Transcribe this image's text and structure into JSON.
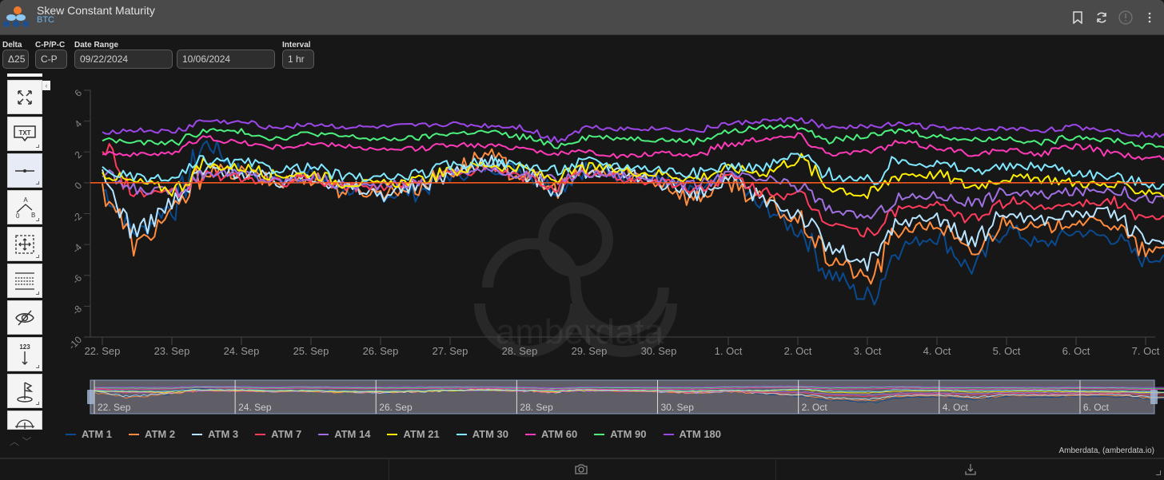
{
  "header": {
    "title": "Skew Constant Maturity",
    "subtitle": "BTC",
    "icons": [
      "bookmark-icon",
      "refresh-icon",
      "info-icon",
      "more-vertical-icon"
    ]
  },
  "controls": {
    "delta": {
      "label": "Delta",
      "value": "Δ25"
    },
    "cp": {
      "label": "C-P/P-C",
      "value": "C-P"
    },
    "date_range": {
      "label": "Date Range",
      "start": "09/22/2024",
      "end": "10/06/2024"
    },
    "interval": {
      "label": "Interval",
      "value": "1 hr"
    }
  },
  "toolbar": {
    "collapse": "‹",
    "tools": [
      {
        "name": "fullscreen",
        "icon": "fullscreen-icon"
      },
      {
        "name": "text-annotation",
        "icon": "text-annotation-icon",
        "label": "TXT"
      },
      {
        "name": "horizontal-line",
        "icon": "horizontal-line-icon",
        "active": true
      },
      {
        "name": "measure-angle",
        "icon": "measure-icon"
      },
      {
        "name": "crosshair-move",
        "icon": "move-icon"
      },
      {
        "name": "fibonacci",
        "icon": "fibonacci-icon"
      },
      {
        "name": "hide-annotations",
        "icon": "eye-off-icon"
      },
      {
        "name": "vertical-counter",
        "icon": "counter-icon",
        "label": "123"
      },
      {
        "name": "flag",
        "icon": "flag-icon"
      },
      {
        "name": "more-tools",
        "icon": "arc-icon"
      }
    ],
    "arrows": "︿ ﹀"
  },
  "chart_data": {
    "type": "line",
    "title": "",
    "xlabel": "",
    "ylabel": "",
    "ylim": [
      -10,
      6
    ],
    "yticks": [
      6,
      4,
      2,
      0,
      -2,
      -4,
      -6,
      -8,
      -10
    ],
    "xticks": [
      "22. Sep",
      "23. Sep",
      "24. Sep",
      "25. Sep",
      "26. Sep",
      "27. Sep",
      "28. Sep",
      "29. Sep",
      "30. Sep",
      "1. Oct",
      "2. Oct",
      "3. Oct",
      "4. Oct",
      "5. Oct",
      "6. Oct",
      "7. Oct"
    ],
    "x_start": "2024-09-22 00:00",
    "x_step_hours": 12,
    "zero_line_color": "#ff5a1f",
    "navigator_ticks": [
      "22. Sep",
      "24. Sep",
      "26. Sep",
      "28. Sep",
      "30. Sep",
      "2. Oct",
      "4. Oct",
      "6. Oct"
    ],
    "legend_position": "bottom-left",
    "series": [
      {
        "name": "ATM 1",
        "color": "#0a4a8f",
        "values": [
          -0.5,
          -3.2,
          -1.5,
          2.5,
          0.8,
          0.3,
          0.5,
          -0.4,
          -0.8,
          -0.6,
          0.5,
          1.0,
          0.9,
          -0.3,
          1.0,
          0.5,
          0.3,
          -0.8,
          0.2,
          -1.6,
          -3.0,
          -6.0,
          -7.5,
          -4.0,
          -3.5,
          -5.5,
          -3.0,
          -4.0,
          -3.2,
          -3.5,
          -5.0,
          -4.2,
          -6.0
        ]
      },
      {
        "name": "ATM 2",
        "color": "#ff8b3d",
        "values": [
          -0.5,
          -4.0,
          -2.0,
          0.8,
          0.6,
          0.0,
          0.4,
          -0.5,
          -0.6,
          -0.3,
          0.8,
          1.8,
          0.6,
          -0.4,
          0.7,
          0.6,
          0.1,
          -1.0,
          0.1,
          -1.2,
          -2.5,
          -5.0,
          -6.2,
          -3.0,
          -2.8,
          -4.6,
          -2.5,
          -3.0,
          -2.5,
          -2.6,
          -4.5,
          -4.2,
          -4.0
        ]
      },
      {
        "name": "ATM 3",
        "color": "#b8e4ff",
        "values": [
          0.0,
          -3.1,
          -1.4,
          0.9,
          0.7,
          0.1,
          0.6,
          -0.3,
          -0.7,
          -0.3,
          0.6,
          1.5,
          0.7,
          -0.3,
          0.9,
          0.4,
          0.2,
          -0.9,
          0.0,
          -1.0,
          -2.0,
          -4.3,
          -5.3,
          -2.5,
          -2.2,
          -3.8,
          -2.0,
          -2.4,
          -2.0,
          -1.9,
          -3.8,
          -3.6,
          -2.0
        ]
      },
      {
        "name": "ATM 7",
        "color": "#ff3b5c",
        "values": [
          2.5,
          -0.7,
          -0.8,
          0.5,
          0.3,
          0.0,
          0.3,
          -0.3,
          -0.2,
          0.0,
          0.6,
          0.9,
          0.4,
          -0.2,
          0.6,
          0.2,
          0.1,
          -0.4,
          0.3,
          -0.5,
          -1.0,
          -2.6,
          -3.3,
          -1.6,
          -1.5,
          -2.4,
          -1.2,
          -1.6,
          -1.3,
          -1.2,
          -2.3,
          -2.0,
          -1.0
        ]
      },
      {
        "name": "ATM 14",
        "color": "#a070e0",
        "values": [
          0.5,
          -0.5,
          -0.5,
          0.7,
          0.6,
          0.1,
          0.4,
          -0.2,
          -0.2,
          0.0,
          0.7,
          0.8,
          0.6,
          0.2,
          0.6,
          0.5,
          0.3,
          -0.2,
          0.5,
          0.2,
          -0.2,
          -1.8,
          -2.2,
          -1.0,
          -0.8,
          -1.3,
          -0.6,
          -0.8,
          -0.6,
          -0.4,
          -1.0,
          -1.2,
          -0.4
        ]
      },
      {
        "name": "ATM 21",
        "color": "#ffee00",
        "values": [
          0.6,
          0.0,
          -0.4,
          1.1,
          1.0,
          0.5,
          0.6,
          0.0,
          -0.1,
          0.1,
          0.7,
          1.2,
          0.9,
          0.3,
          1.0,
          0.8,
          0.6,
          0.3,
          0.9,
          0.7,
          1.5,
          -0.3,
          -0.8,
          0.6,
          0.5,
          -0.2,
          0.3,
          0.3,
          0.0,
          -0.2,
          -0.5,
          -0.9,
          0.4
        ]
      },
      {
        "name": "ATM 30",
        "color": "#80e8ff",
        "values": [
          0.8,
          0.3,
          0.2,
          1.4,
          1.3,
          0.9,
          1.0,
          0.4,
          0.3,
          0.5,
          1.1,
          1.4,
          1.2,
          0.8,
          1.4,
          1.1,
          0.9,
          0.6,
          1.1,
          1.0,
          1.8,
          0.5,
          0.0,
          1.5,
          1.2,
          0.8,
          1.0,
          1.1,
          0.7,
          0.4,
          0.0,
          -0.4,
          0.4
        ]
      },
      {
        "name": "ATM 60",
        "color": "#ff3ab8",
        "values": [
          2.0,
          1.8,
          2.0,
          2.9,
          2.6,
          2.3,
          2.5,
          2.4,
          2.1,
          2.2,
          2.5,
          2.4,
          2.3,
          1.9,
          2.0,
          1.7,
          1.9,
          1.8,
          2.5,
          2.9,
          3.0,
          1.9,
          2.0,
          2.6,
          2.3,
          1.9,
          2.1,
          1.9,
          2.4,
          1.9,
          1.6,
          1.7,
          2.1
        ]
      },
      {
        "name": "ATM 90",
        "color": "#4cf07c",
        "values": [
          2.8,
          2.6,
          2.6,
          3.4,
          3.3,
          2.9,
          3.2,
          3.0,
          2.8,
          2.9,
          3.2,
          3.3,
          3.0,
          2.4,
          3.0,
          2.9,
          2.8,
          2.7,
          3.3,
          3.6,
          3.7,
          2.8,
          3.0,
          3.4,
          3.0,
          2.8,
          2.9,
          2.6,
          3.0,
          2.8,
          2.4,
          2.3,
          2.9
        ]
      },
      {
        "name": "ATM 180",
        "color": "#9d47e8",
        "values": [
          3.3,
          3.4,
          3.3,
          4.0,
          3.9,
          3.6,
          3.8,
          3.6,
          3.6,
          3.7,
          3.8,
          3.7,
          3.6,
          2.8,
          3.6,
          3.5,
          3.5,
          3.4,
          3.8,
          4.0,
          4.1,
          3.5,
          3.7,
          3.8,
          3.6,
          3.4,
          3.5,
          3.4,
          3.6,
          3.4,
          3.1,
          3.0,
          3.1
        ]
      }
    ]
  },
  "credits": "Amberdata, (amberdata.io)",
  "bottom": {
    "icons": [
      "camera-icon",
      "download-icon"
    ]
  }
}
